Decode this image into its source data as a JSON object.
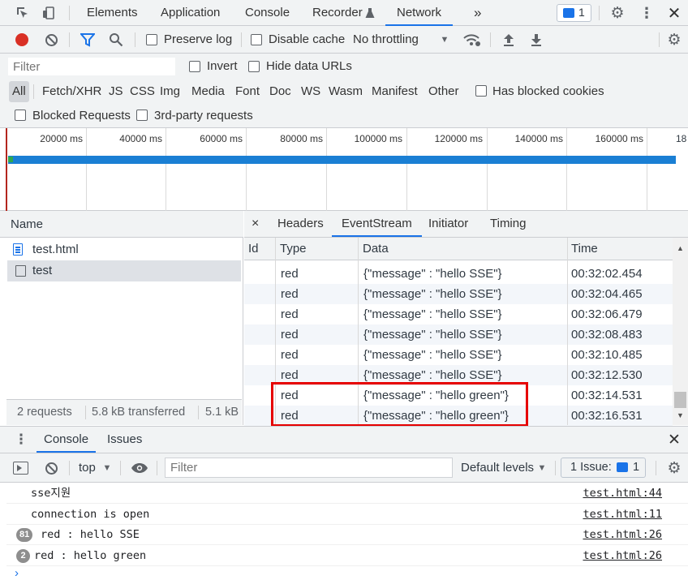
{
  "tabs": {
    "items": [
      "Elements",
      "Application",
      "Console",
      "Recorder",
      "Network"
    ],
    "more": "»",
    "issues_count": "1"
  },
  "network_toolbar": {
    "preserve_log": "Preserve log",
    "disable_cache": "Disable cache",
    "throttling": "No throttling"
  },
  "filter": {
    "placeholder": "Filter",
    "invert": "Invert",
    "hide_data_urls": "Hide data URLs"
  },
  "types": [
    "All",
    "Fetch/XHR",
    "JS",
    "CSS",
    "Img",
    "Media",
    "Font",
    "Doc",
    "WS",
    "Wasm",
    "Manifest",
    "Other"
  ],
  "has_blocked_cookies": "Has blocked cookies",
  "blocked_requests": "Blocked Requests",
  "third_party": "3rd-party requests",
  "overview_ticks": [
    "20000 ms",
    "40000 ms",
    "60000 ms",
    "80000 ms",
    "100000 ms",
    "120000 ms",
    "140000 ms",
    "160000 ms",
    "18"
  ],
  "requests": {
    "header": "Name",
    "items": [
      "test.html",
      "test"
    ],
    "status": {
      "count": "2 requests",
      "transferred": "5.8 kB transferred",
      "resources": "5.1 kB"
    }
  },
  "detail_tabs": {
    "close": "×",
    "items": [
      "Headers",
      "EventStream",
      "Initiator",
      "Timing"
    ]
  },
  "eventstream": {
    "columns": [
      "Id",
      "Type",
      "Data",
      "Time"
    ],
    "rows": [
      {
        "type": "red",
        "data": "{\"message\" : \"hello SSE\"}",
        "time": "00:32:02.454"
      },
      {
        "type": "red",
        "data": "{\"message\" : \"hello SSE\"}",
        "time": "00:32:04.465"
      },
      {
        "type": "red",
        "data": "{\"message\" : \"hello SSE\"}",
        "time": "00:32:06.479"
      },
      {
        "type": "red",
        "data": "{\"message\" : \"hello SSE\"}",
        "time": "00:32:08.483"
      },
      {
        "type": "red",
        "data": "{\"message\" : \"hello SSE\"}",
        "time": "00:32:10.485"
      },
      {
        "type": "red",
        "data": "{\"message\" : \"hello SSE\"}",
        "time": "00:32:12.530"
      },
      {
        "type": "red",
        "data": "{\"message\" : \"hello green\"}",
        "time": "00:32:14.531"
      },
      {
        "type": "red",
        "data": "{\"message\" : \"hello green\"}",
        "time": "00:32:16.531"
      }
    ]
  },
  "drawer": {
    "tabs": [
      "Console",
      "Issues"
    ],
    "context": "top",
    "filter_placeholder": "Filter",
    "levels": "Default levels",
    "issues_label": "1 Issue:",
    "issues_count": "1"
  },
  "console": {
    "messages": [
      {
        "badge": "",
        "text": "sse지원",
        "source": "test.html:44"
      },
      {
        "badge": "",
        "text": "connection is open",
        "source": "test.html:11"
      },
      {
        "badge": "81",
        "text": "red : hello SSE",
        "source": "test.html:26"
      },
      {
        "badge": "2",
        "text": "red : hello green",
        "source": "test.html:26"
      }
    ],
    "prompt": "›"
  },
  "colors": {
    "accent": "#1a73e8",
    "record": "#d93025",
    "highlight_box": "#e60000",
    "timeline_bar": "#1a7fd4"
  }
}
